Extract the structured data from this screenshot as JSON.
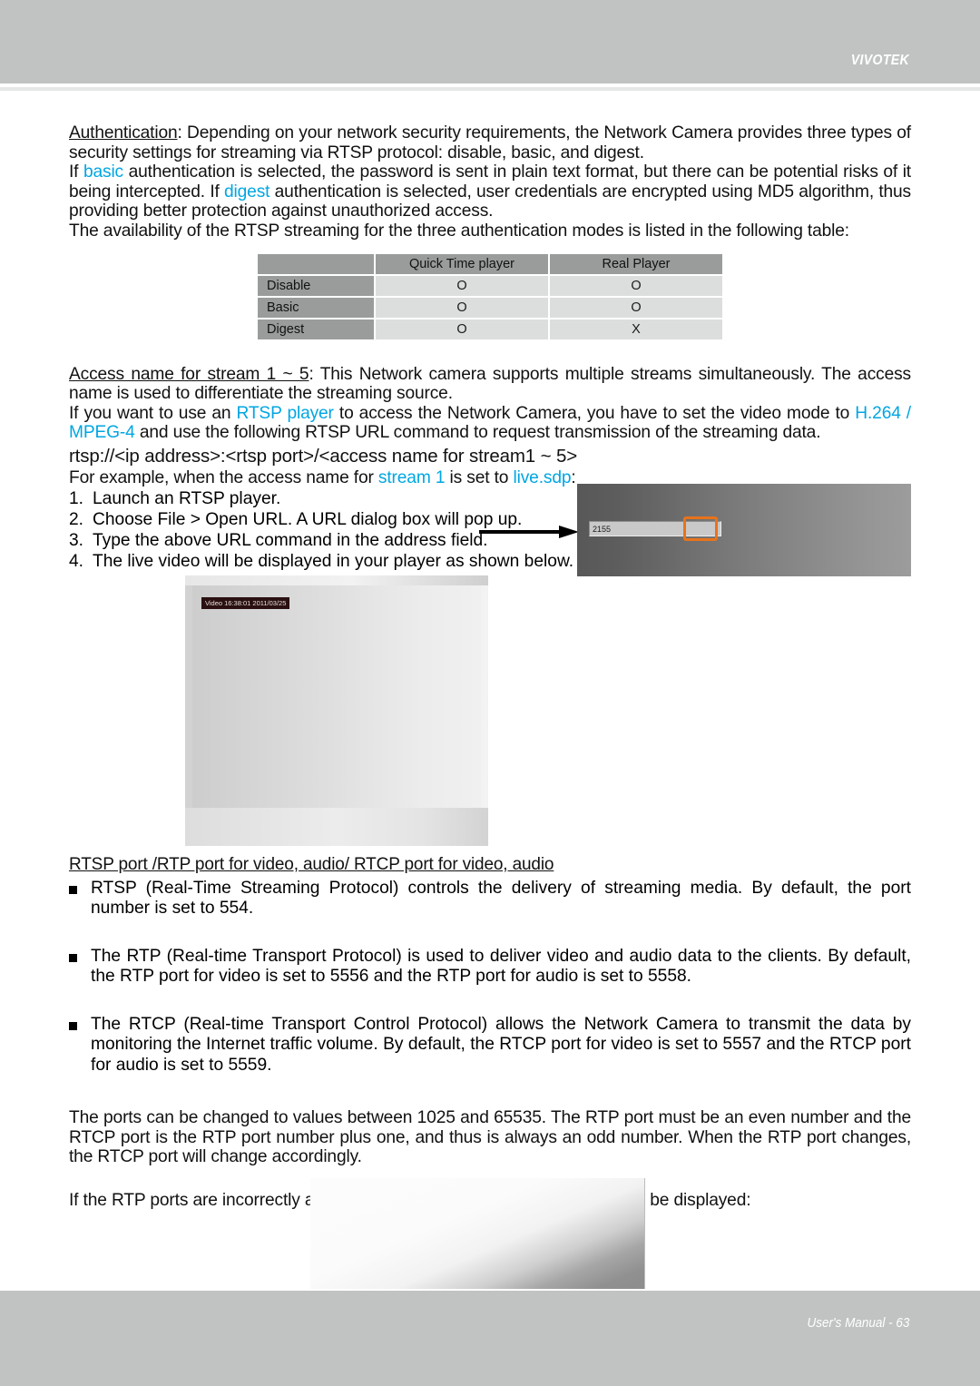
{
  "header": {
    "brand": "VIVOTEK"
  },
  "footer": {
    "text": "User's Manual - 63"
  },
  "body": {
    "auth_heading": "Authentication",
    "auth_p1_rest": ": Depending on your network security requirements, the Network Camera provides three types of security settings for streaming via RTSP protocol: disable, basic, and digest.",
    "auth_p2_a": "If ",
    "auth_p2_basic": "basic",
    "auth_p2_b": " authentication is selected, the password is sent in plain text format, but there can be potential risks of it being intercepted. If ",
    "auth_p2_digest": "digest",
    "auth_p2_c": " authentication is selected, user credentials are encrypted using MD5 algorithm, thus providing better protection against unauthorized access.",
    "auth_p3": "The availability of the RTSP streaming for the three authentication modes is listed in the following table:",
    "access_heading": "Access name for stream 1 ~ 5",
    "access_p1_rest": ": This Network camera supports multiple streams simultaneously. The access name is used to differentiate the streaming source.",
    "access_p2_a": "If you want to use an ",
    "access_p2_rtsp": "RTSP player",
    "access_p2_b": " to access the Network Camera, you have to set the video mode to ",
    "access_p2_codec": "H.264 / MPEG-4",
    "access_p2_c": " and use the following RTSP URL command to request transmission of the streaming data.",
    "rtsp_url": "rtsp://<ip address>:<rtsp port>/<access name for stream1 ~ 5>",
    "example_a": "For example, when the access name for ",
    "example_stream": "stream 1",
    "example_b": " is set to ",
    "example_sdp": "live.sdp",
    "example_c": ":",
    "ports_heading": "RTSP port /RTP port for video, audio/ RTCP port for video, audio",
    "ports_p1": "The ports can be changed to values between 1025 and 65535. The RTP port must be an even number and the RTCP port is the RTP port number plus one, and thus is always an odd number. When the RTP port changes, the RTCP port will change accordingly.",
    "ports_p2": "If the RTP ports are incorrectly assigned, the following warning message will be displayed:"
  },
  "table": {
    "corner": "",
    "columns": [
      "Quick Time player",
      "Real Player"
    ],
    "rows": [
      {
        "label": "Disable",
        "values": [
          "O",
          "O"
        ]
      },
      {
        "label": "Basic",
        "values": [
          "O",
          "O"
        ]
      },
      {
        "label": "Digest",
        "values": [
          "O",
          "X"
        ]
      }
    ]
  },
  "steps": [
    {
      "num": "1.",
      "text": "Launch an RTSP player."
    },
    {
      "num": "2.",
      "text": "Choose File > Open URL. A URL dialog box will pop up."
    },
    {
      "num": "3.",
      "text": "Type the above URL command in the address field."
    },
    {
      "num": "4.",
      "text": "The live video will be displayed in your player as shown below."
    }
  ],
  "url_dialog": {
    "field_value": "2155"
  },
  "player": {
    "osd_text": "Video 16:38:01 2011/03/25"
  },
  "bullets": [
    "RTSP (Real-Time Streaming Protocol) controls the delivery of streaming media. By default, the port number is set to 554.",
    "The RTP (Real-time Transport Protocol) is used to deliver video and audio data to the clients. By default, the RTP port for video is set to 5556 and the RTP port for audio is set to 5558.",
    "The RTCP (Real-time Transport Control Protocol) allows the Network Camera to transmit the data by monitoring the Internet traffic volume. By default, the RTCP port for video is set to 5557 and the RTCP port for audio is set to 5559."
  ],
  "colors": {
    "accent_cyan": "#00a6e2",
    "highlight_orange": "#e8731b",
    "chrome_gray": "#c1c3c3"
  }
}
